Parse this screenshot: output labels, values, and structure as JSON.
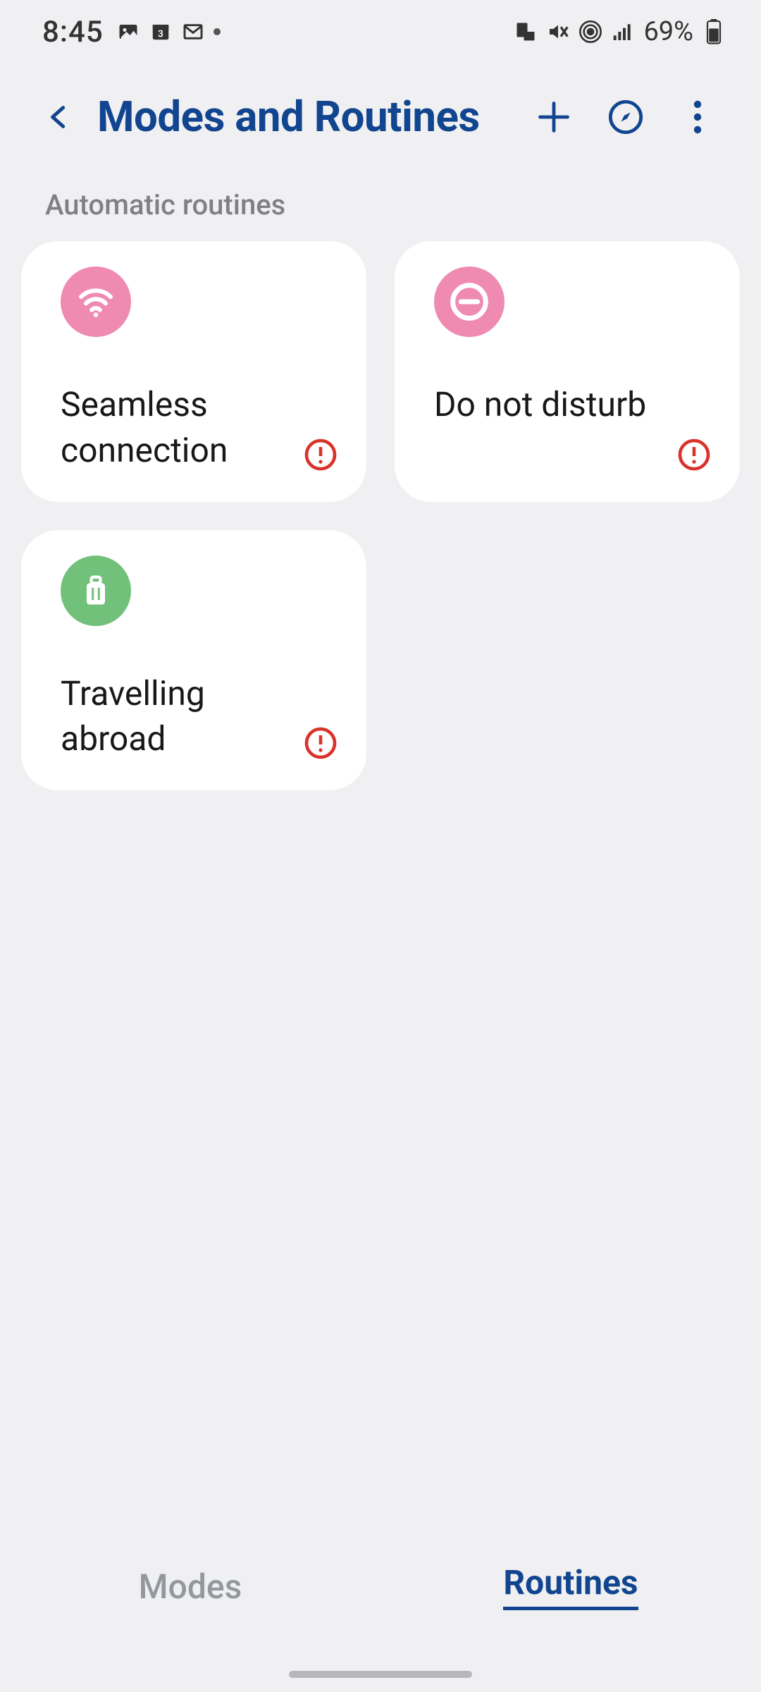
{
  "status": {
    "time": "8:45",
    "notif_icons": [
      "photos-icon",
      "calendar-3-icon",
      "gmail-icon",
      "more-dot"
    ],
    "system_icons": [
      "card-icon",
      "vibrate-icon",
      "hotspot-icon",
      "signal-icon"
    ],
    "battery_text": "69%"
  },
  "header": {
    "title": "Modes and Routines"
  },
  "section": {
    "label": "Automatic routines"
  },
  "routines": [
    {
      "title": "Seamless connection",
      "icon": "wifi-icon",
      "color": "pink",
      "alert": true
    },
    {
      "title": "Do not disturb",
      "icon": "dnd-icon",
      "color": "pink",
      "alert": true
    },
    {
      "title": "Travelling abroad",
      "icon": "luggage-icon",
      "color": "green",
      "alert": true
    }
  ],
  "tabs": {
    "modes": "Modes",
    "routines": "Routines",
    "active": "routines"
  }
}
